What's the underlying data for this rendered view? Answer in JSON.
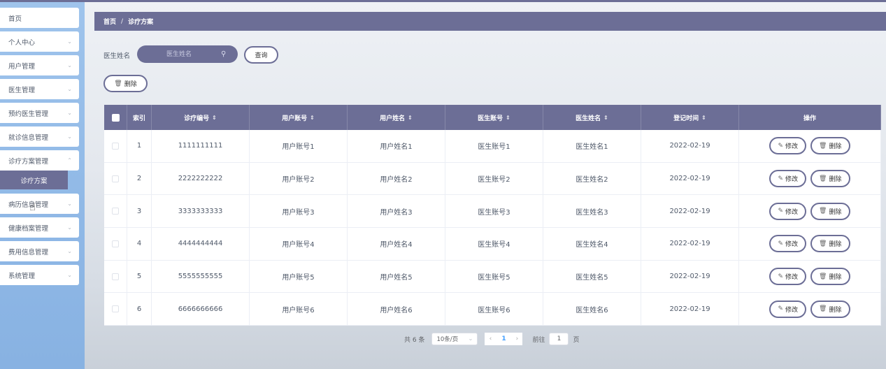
{
  "sidebar": {
    "items": [
      {
        "label": "首页",
        "chevron": false
      },
      {
        "label": "个人中心",
        "chevron": true
      },
      {
        "label": "用户管理",
        "chevron": true
      },
      {
        "label": "医生管理",
        "chevron": true
      },
      {
        "label": "预约医生管理",
        "chevron": true
      },
      {
        "label": "就诊信息管理",
        "chevron": true
      },
      {
        "label": "诊疗方案管理",
        "chevron": true
      },
      {
        "label": "病历信息管理",
        "chevron": true
      },
      {
        "label": "健康档案管理",
        "chevron": true
      },
      {
        "label": "费用信息管理",
        "chevron": true
      },
      {
        "label": "系统管理",
        "chevron": true
      }
    ],
    "active_sub": "诊疗方案"
  },
  "breadcrumb": {
    "home": "首页",
    "separator": "/",
    "current": "诊疗方案"
  },
  "search": {
    "label": "医生姓名",
    "placeholder": "医生姓名",
    "query_button": "查询"
  },
  "toolbar": {
    "delete_label": "删除"
  },
  "table": {
    "columns": [
      "索引",
      "诊疗编号",
      "用户账号",
      "用户姓名",
      "医生账号",
      "医生姓名",
      "登记时间",
      "操作"
    ],
    "sortable": [
      false,
      true,
      true,
      true,
      true,
      true,
      true,
      false
    ],
    "rows": [
      {
        "index": "1",
        "code": "1111111111",
        "user_account": "用户账号1",
        "user_name": "用户姓名1",
        "doctor_account": "医生账号1",
        "doctor_name": "医生姓名1",
        "date": "2022-02-19"
      },
      {
        "index": "2",
        "code": "2222222222",
        "user_account": "用户账号2",
        "user_name": "用户姓名2",
        "doctor_account": "医生账号2",
        "doctor_name": "医生姓名2",
        "date": "2022-02-19"
      },
      {
        "index": "3",
        "code": "3333333333",
        "user_account": "用户账号3",
        "user_name": "用户姓名3",
        "doctor_account": "医生账号3",
        "doctor_name": "医生姓名3",
        "date": "2022-02-19"
      },
      {
        "index": "4",
        "code": "4444444444",
        "user_account": "用户账号4",
        "user_name": "用户姓名4",
        "doctor_account": "医生账号4",
        "doctor_name": "医生姓名4",
        "date": "2022-02-19"
      },
      {
        "index": "5",
        "code": "5555555555",
        "user_account": "用户账号5",
        "user_name": "用户姓名5",
        "doctor_account": "医生账号5",
        "doctor_name": "医生姓名5",
        "date": "2022-02-19"
      },
      {
        "index": "6",
        "code": "6666666666",
        "user_account": "用户账号6",
        "user_name": "用户姓名6",
        "doctor_account": "医生账号6",
        "doctor_name": "医生姓名6",
        "date": "2022-02-19"
      }
    ],
    "edit_label": "修改",
    "delete_label": "删除"
  },
  "pagination": {
    "total_text": "共 6 条",
    "page_size": "10条/页",
    "current_page": "1",
    "goto_prefix": "前往",
    "goto_value": "1",
    "goto_suffix": "页"
  },
  "colors": {
    "accent": "#6c6e96",
    "sidebar": "#9fc4ec",
    "page_active": "#409eff"
  },
  "icons": {
    "search": "search-icon",
    "delete": "trash-icon",
    "edit": "pencil-icon",
    "chevron": "chevron-down-icon"
  }
}
